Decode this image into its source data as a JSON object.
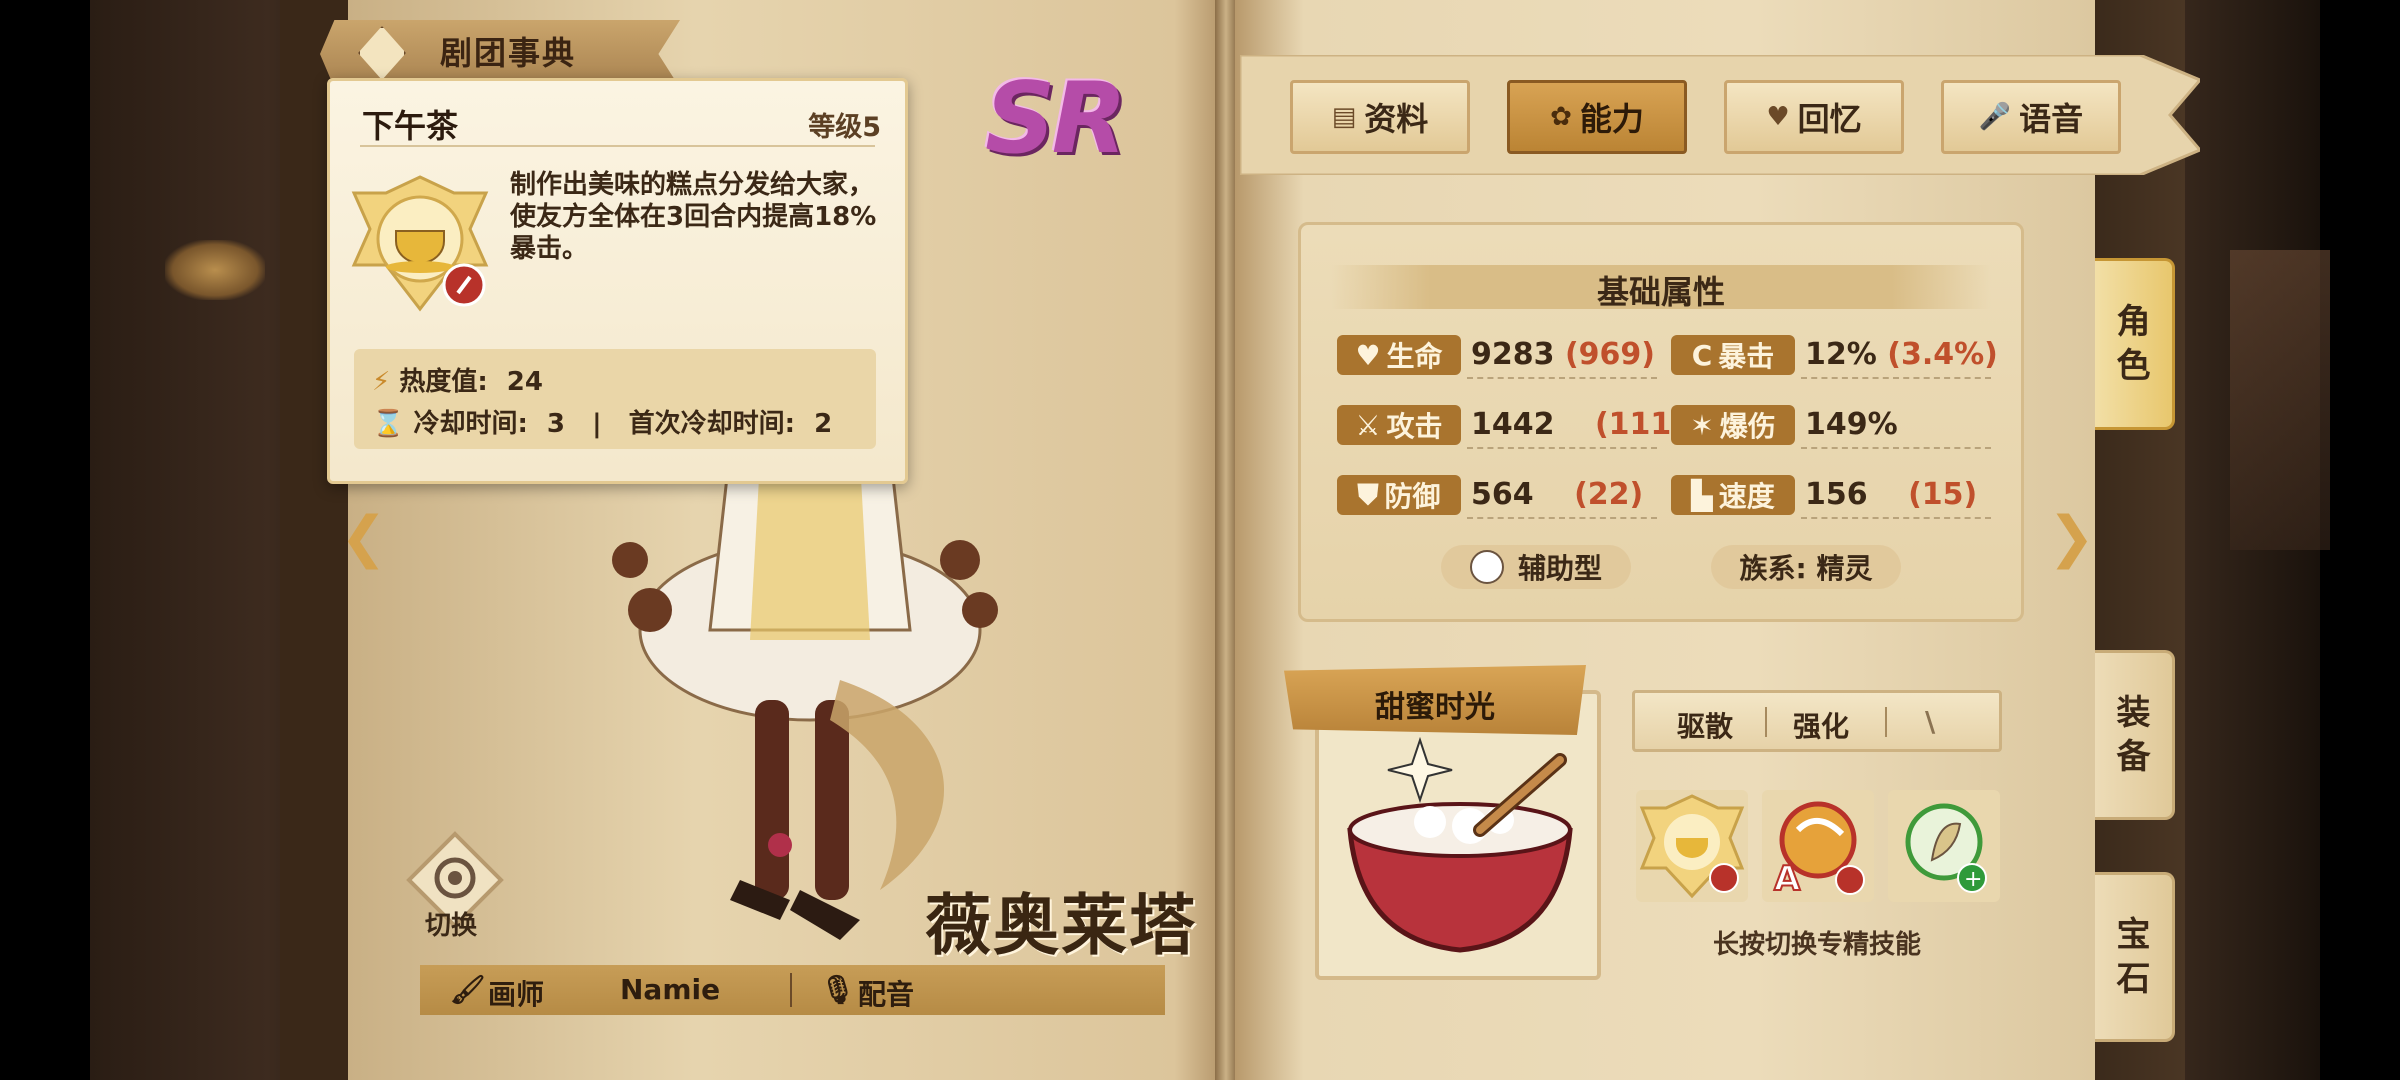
{
  "header": {
    "codex_title": "剧团事典",
    "rarity": "SR"
  },
  "tooltip": {
    "title": "下午茶",
    "level": "等级5",
    "description": "制作出美味的糕点分发给大家，使友方全体在3回合内提高18%暴击。",
    "heat_label": "热度值:",
    "heat_value": "24",
    "cooldown_label": "冷却时间:",
    "cooldown_value": "3",
    "first_cooldown_label": "首次冷却时间:",
    "first_cooldown_value": "2"
  },
  "character": {
    "name": "薇奥莱塔",
    "swap_label": "切换"
  },
  "credits": {
    "artist_label": "画师",
    "artist": "Namie",
    "voice_label": "配音"
  },
  "tabs": [
    {
      "label": "资料",
      "icon": "document-icon"
    },
    {
      "label": "能力",
      "icon": "paw-icon"
    },
    {
      "label": "回忆",
      "icon": "heart-icon"
    },
    {
      "label": "语音",
      "icon": "microphone-icon"
    }
  ],
  "attributes": {
    "title": "基础属性",
    "stats": [
      {
        "label": "生命",
        "value": "9283",
        "bonus": "(969)"
      },
      {
        "label": "暴击",
        "value": "12%",
        "bonus": "(3.4%)"
      },
      {
        "label": "攻击",
        "value": "1442",
        "bonus": "(111)"
      },
      {
        "label": "爆伤",
        "value": "149%",
        "bonus": ""
      },
      {
        "label": "防御",
        "value": "564",
        "bonus": "(22)"
      },
      {
        "label": "速度",
        "value": "156",
        "bonus": "(15)"
      }
    ],
    "role": "辅助型",
    "race": "族系: 精灵"
  },
  "skill": {
    "name": "甜蜜时光",
    "tabs": [
      "驱散",
      "强化",
      "\\"
    ],
    "hint": "长按切换专精技能"
  },
  "side_tabs": [
    {
      "label": "角色"
    },
    {
      "label": "装备"
    },
    {
      "label": "宝石"
    }
  ],
  "colors": {
    "accent": "#a9742e",
    "bonus": "#c0502c",
    "rarity": "#b54ca8",
    "page": "#ecdcba"
  }
}
